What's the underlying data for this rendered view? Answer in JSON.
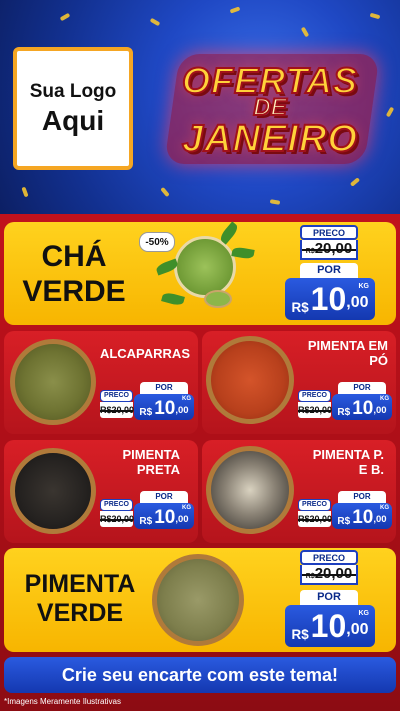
{
  "logo": {
    "line1": "Sua Logo",
    "line2": "Aqui"
  },
  "banner": {
    "line1": "OFERTAS",
    "line2": "DE",
    "line3": "JANEIRO"
  },
  "featured": [
    {
      "name_line1": "CHÁ",
      "name_line2": "VERDE",
      "discount_badge": "-50%",
      "preco_label": "PRECO",
      "old_currency": "R$",
      "old_price": "20,00",
      "por_label": "POR",
      "currency": "R$",
      "price_int": "10",
      "price_cents": ",00",
      "unit": "KG"
    },
    {
      "name_line1": "PIMENTA",
      "name_line2": "VERDE",
      "preco_label": "PRECO",
      "old_currency": "R$",
      "old_price": "20,00",
      "por_label": "POR",
      "currency": "R$",
      "price_int": "10",
      "price_cents": ",00",
      "unit": "KG"
    }
  ],
  "products": [
    {
      "name_line1": "ALCAPARRAS",
      "name_line2": "",
      "preco_label": "PRECO",
      "old_price": "R$20,00",
      "por_label": "POR",
      "currency": "R$",
      "price_int": "10",
      "price_cents": ",00",
      "unit": "KG"
    },
    {
      "name_line1": "PIMENTA EM",
      "name_line2": "PÓ",
      "preco_label": "PRECO",
      "old_price": "R$20,00",
      "por_label": "POR",
      "currency": "R$",
      "price_int": "10",
      "price_cents": ",00",
      "unit": "KG"
    },
    {
      "name_line1": "PIMENTA",
      "name_line2": "PRETA",
      "preco_label": "PRECO",
      "old_price": "R$20,00",
      "por_label": "POR",
      "currency": "R$",
      "price_int": "10",
      "price_cents": ",00",
      "unit": "KG"
    },
    {
      "name_line1": "PIMENTA P.",
      "name_line2": "E B.",
      "preco_label": "PRECO",
      "old_price": "R$20,00",
      "por_label": "POR",
      "currency": "R$",
      "price_int": "10",
      "price_cents": ",00",
      "unit": "KG"
    }
  ],
  "cta": "Crie seu encarte com este tema!",
  "disclaimer": "*Imagens Meramente Ilustrativas",
  "colors": {
    "yellow": "#ffd21e",
    "red": "#c1121c",
    "blue": "#1f48c4",
    "accent_gold": "#f5a623"
  }
}
